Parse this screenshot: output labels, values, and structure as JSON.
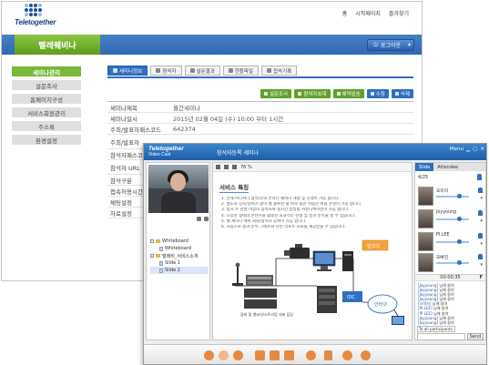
{
  "admin": {
    "logo_text": "Teletogether",
    "top_links": [
      "홈",
      "시작페이지",
      "즐겨찾기"
    ],
    "section_title": "텔레웨비나",
    "logout_label": "로그아웃",
    "sidebar": [
      {
        "label": "세미나관리",
        "active": true
      },
      {
        "label": "설문조사",
        "active": false
      },
      {
        "label": "홈페이지구성",
        "active": false
      },
      {
        "label": "서비스회원관리",
        "active": false
      },
      {
        "label": "주소록",
        "active": false
      },
      {
        "label": "환경설정",
        "active": false
      }
    ],
    "tabs": [
      {
        "label": "세미나정보",
        "active": true
      },
      {
        "label": "참석자",
        "active": false
      },
      {
        "label": "설문결과",
        "active": false
      },
      {
        "label": "현황파일",
        "active": false
      },
      {
        "label": "접속기록",
        "active": false
      }
    ],
    "actions": [
      {
        "label": "설문조사",
        "style": "green"
      },
      {
        "label": "참석자초대",
        "style": "green"
      },
      {
        "label": "예약발송",
        "style": "green"
      },
      {
        "label": "수정",
        "style": "blue"
      },
      {
        "label": "삭제",
        "style": "blue"
      }
    ],
    "info_rows": [
      {
        "label": "세미나제목",
        "value": "월간세미나"
      },
      {
        "label": "세미나일시",
        "value": "2015년 02월 04일 (수) 10:00 부터 1시간"
      },
      {
        "label": "주최/발표자패스코드",
        "value": "642374"
      },
      {
        "label": "주최/발표자",
        "value": ""
      },
      {
        "label": "참석자패스코드",
        "value": ""
      },
      {
        "label": "참석자 URL",
        "value": ""
      },
      {
        "label": "참석구분",
        "value": ""
      },
      {
        "label": "접속허용시간",
        "value": ""
      },
      {
        "label": "채팅설정",
        "value": ""
      },
      {
        "label": "자료설정",
        "value": ""
      }
    ]
  },
  "videocast": {
    "brand": "Teletogether",
    "brand_sub": "Video Cast",
    "window_title": "참석자등록 세미나",
    "menu_label": "Menu",
    "tree": [
      {
        "label": "Whiteboard",
        "kind": "folder",
        "selected": false
      },
      {
        "label": "Whiteboard",
        "kind": "page",
        "selected": false
      },
      {
        "label": "텔레비_서비스소개",
        "kind": "folder",
        "selected": false
      },
      {
        "label": "Slide 1",
        "kind": "page",
        "selected": false
      },
      {
        "label": "Slide 2",
        "kind": "page",
        "selected": true
      }
    ],
    "zoom": "76 %",
    "doc_title": "서비스 특징",
    "doc_lines": [
      "1. 언제 어디서나 참석/강의 온라인 웨비나 개설 및 진행이 가능 합니다.",
      "2. 별도의 장소/장비가 없이 웹 솔루션 을 바로 통한 저렴한 비용 운영이 가능 합니다.",
      "3. 동시 수 천명 이상의 참석자와 실시간 양방향 커뮤니케이션이 가능 합니다.",
      "4. 다양한 형태의 콘텐츠를 활용한 효과적인 진행 및 결과 분석을 할 수 있습니다.",
      "5. 웹 세미나 에서 회원/참석자 등록이 가능 합니다.",
      "6. 자동으로 결과 분석 그래프와 관련 리포트 자료를 제공받을 수 있습니다."
    ],
    "diagram_labels": {
      "mic": "",
      "mixer": "",
      "camera": "",
      "computer": "",
      "server": "",
      "encoder": "엔코더",
      "idc": "IDC",
      "cdn": "인터넷",
      "mixer_caption": "장비 및 엔코더/스트리밍 서버 담당"
    },
    "right_tabs": [
      "Slide",
      "Attendee"
    ],
    "participant_count": "4/25",
    "participants": [
      {
        "name": "오미자"
      },
      {
        "name": "Joyyoung"
      },
      {
        "name": "PI LEE"
      },
      {
        "name": "오빠진"
      }
    ],
    "chat_time": "00:00:35",
    "chat_lines": [
      {
        "user": "[Joyyoung]",
        "text": " 님께 참여"
      },
      {
        "user": "[Joyyoung]",
        "text": " 님께 참여"
      },
      {
        "user": "[Joyyoung]",
        "text": " 님께 참여"
      },
      {
        "user": "[Joyyoung]",
        "text": " 님께 참여"
      },
      {
        "user": "[오미자]",
        "text": " 님께 참여"
      },
      {
        "user": "[PI LEE]",
        "text": " 님께 참여"
      },
      {
        "user": "[PI LEE]",
        "text": " 님께 참여"
      },
      {
        "user": "[Joyyoung]",
        "text": " 님께 참여"
      },
      {
        "user": "[Joyyoung]",
        "text": " 님께 참여"
      }
    ],
    "chat_target": "To all participants",
    "chat_input_value": "",
    "send_label": "Send",
    "bottom_icons": [
      "person-icon",
      "people-icon",
      "share-icon",
      "document-icon",
      "chart-icon",
      "monitor-icon",
      "chat-icon",
      "lock-icon",
      "record-icon",
      "power-icon"
    ],
    "colors": {
      "accent": "#2f6fbf",
      "brand_green": "#7ab735",
      "bottom_icons": "#e58a43"
    }
  }
}
